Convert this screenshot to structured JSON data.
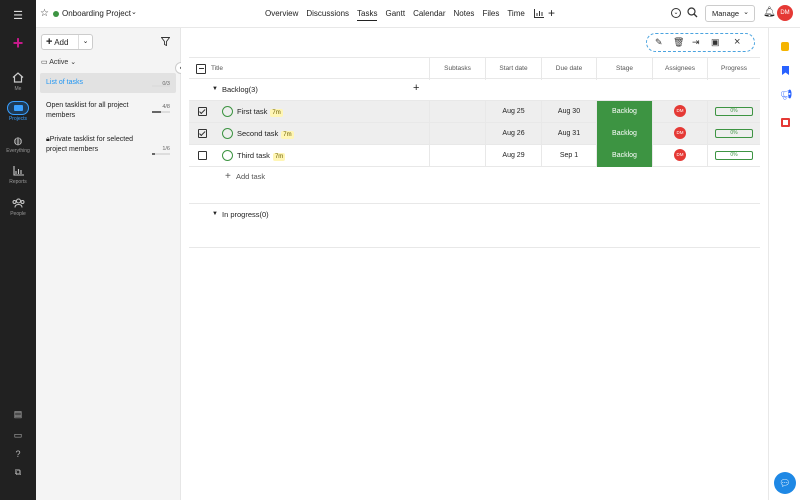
{
  "header": {
    "project_title": "Onboarding Project",
    "nav": [
      "Overview",
      "Discussions",
      "Tasks",
      "Gantt",
      "Calendar",
      "Notes",
      "Files",
      "Time"
    ],
    "active_nav": "Tasks",
    "manage_label": "Manage",
    "avatar_initials": "DM"
  },
  "rail": {
    "me": "Me",
    "projects": "Projects",
    "everything": "Everything",
    "reports": "Reports",
    "people": "People"
  },
  "sidebar": {
    "add_label": "Add",
    "filter_label": "Active",
    "lists": [
      {
        "name": "List of tasks",
        "count": "0/3",
        "progress": 0
      },
      {
        "name": "Open tasklist for all project members",
        "count": "4/8",
        "progress": 0.5
      },
      {
        "name": "Private tasklist for selected project members",
        "count": "1/6",
        "progress": 0.17
      }
    ]
  },
  "table": {
    "headers": {
      "title": "Title",
      "subtasks": "Subtasks",
      "start": "Start date",
      "due": "Due date",
      "stage": "Stage",
      "assignees": "Assignees",
      "progress": "Progress"
    },
    "group_backlog": "Backlog(3)",
    "group_inprogress": "In progress(0)",
    "add_task": "Add task",
    "tasks": [
      {
        "title": "First task",
        "estimate": "7m",
        "start": "Aug 25",
        "due": "Aug 30",
        "stage": "Backlog",
        "assignee": "DM",
        "progress": "0%",
        "checked": true
      },
      {
        "title": "Second task",
        "estimate": "7m",
        "start": "Aug 26",
        "due": "Aug 31",
        "stage": "Backlog",
        "assignee": "DM",
        "progress": "0%",
        "checked": true
      },
      {
        "title": "Third task",
        "estimate": "7m",
        "start": "Aug 29",
        "due": "Sep 1",
        "stage": "Backlog",
        "assignee": "DM",
        "progress": "0%",
        "checked": false
      }
    ]
  },
  "colors": {
    "accent": "#3d9442",
    "brand": "#c51a8a",
    "rail": "#212121",
    "avatar": "#e53935"
  }
}
